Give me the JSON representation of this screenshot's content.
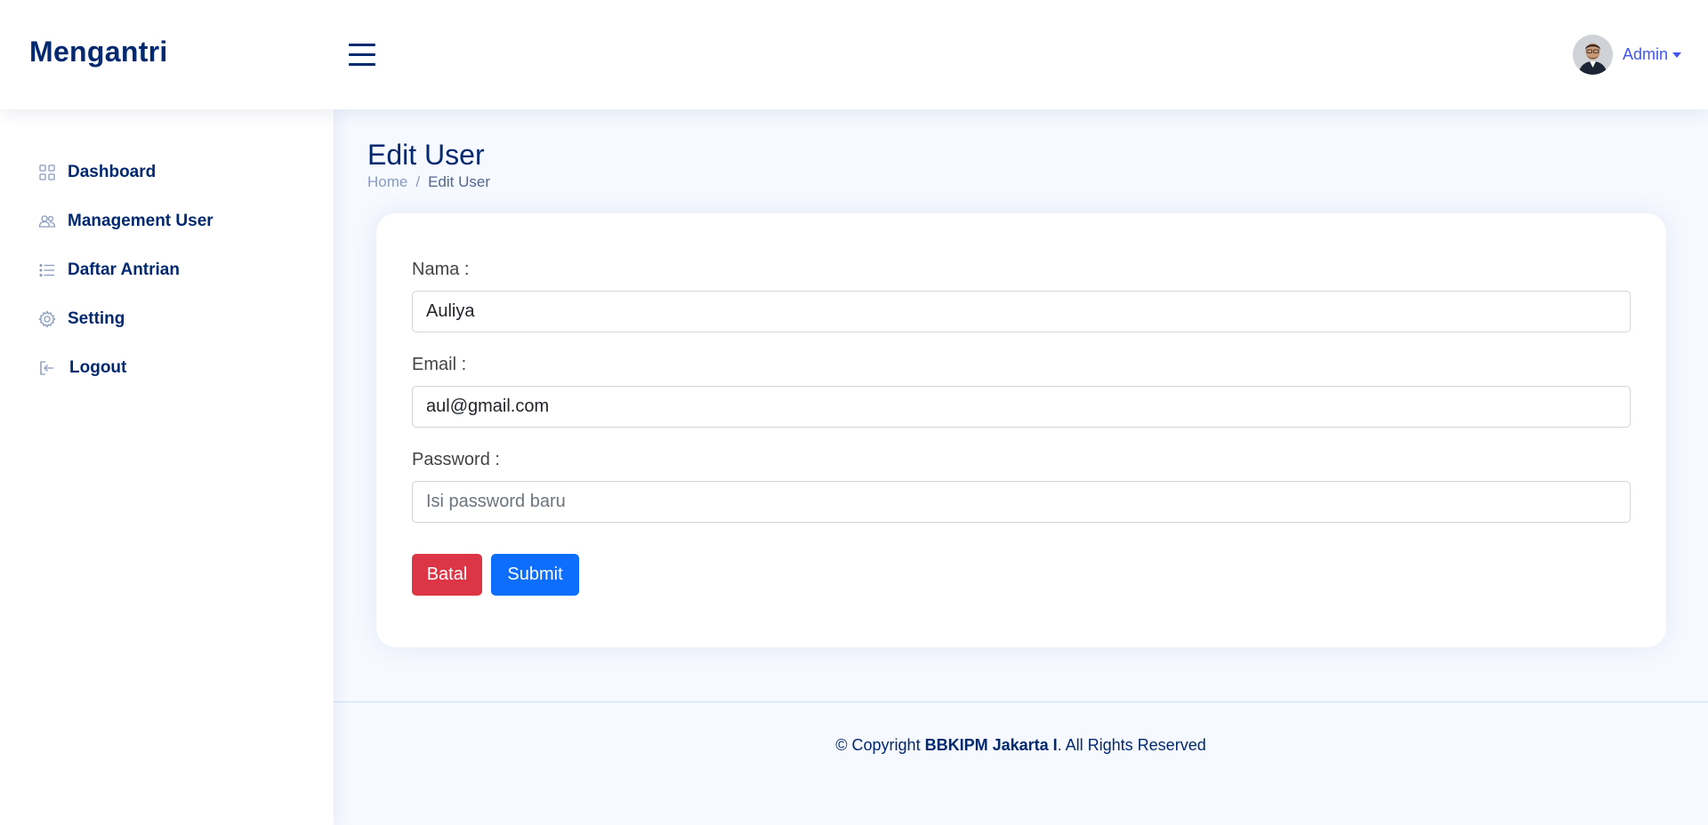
{
  "header": {
    "logo": "Mengantri",
    "profile_name": "Admin"
  },
  "sidebar": {
    "items": [
      {
        "label": "Dashboard",
        "icon": "grid-icon"
      },
      {
        "label": "Management User",
        "icon": "people-icon"
      },
      {
        "label": "Daftar Antrian",
        "icon": "list-icon"
      },
      {
        "label": "Setting",
        "icon": "gear-icon"
      },
      {
        "label": "Logout",
        "icon": "logout-icon"
      }
    ]
  },
  "main": {
    "title": "Edit User",
    "breadcrumb": {
      "home": "Home",
      "separator": "/",
      "current": "Edit User"
    }
  },
  "form": {
    "nama_label": "Nama :",
    "nama_value": "Auliya",
    "email_label": "Email :",
    "email_value": "aul@gmail.com",
    "password_label": "Password :",
    "password_placeholder": "Isi password baru",
    "batal_label": "Batal",
    "submit_label": "Submit"
  },
  "footer": {
    "prefix": "© Copyright ",
    "company": "BBKIPM Jakarta I",
    "suffix": ". All Rights Reserved"
  },
  "colors": {
    "brand": "#012970",
    "accent": "#4154f1",
    "danger": "#dc3545",
    "primary": "#0d6efd",
    "background": "#f6f9ff"
  }
}
